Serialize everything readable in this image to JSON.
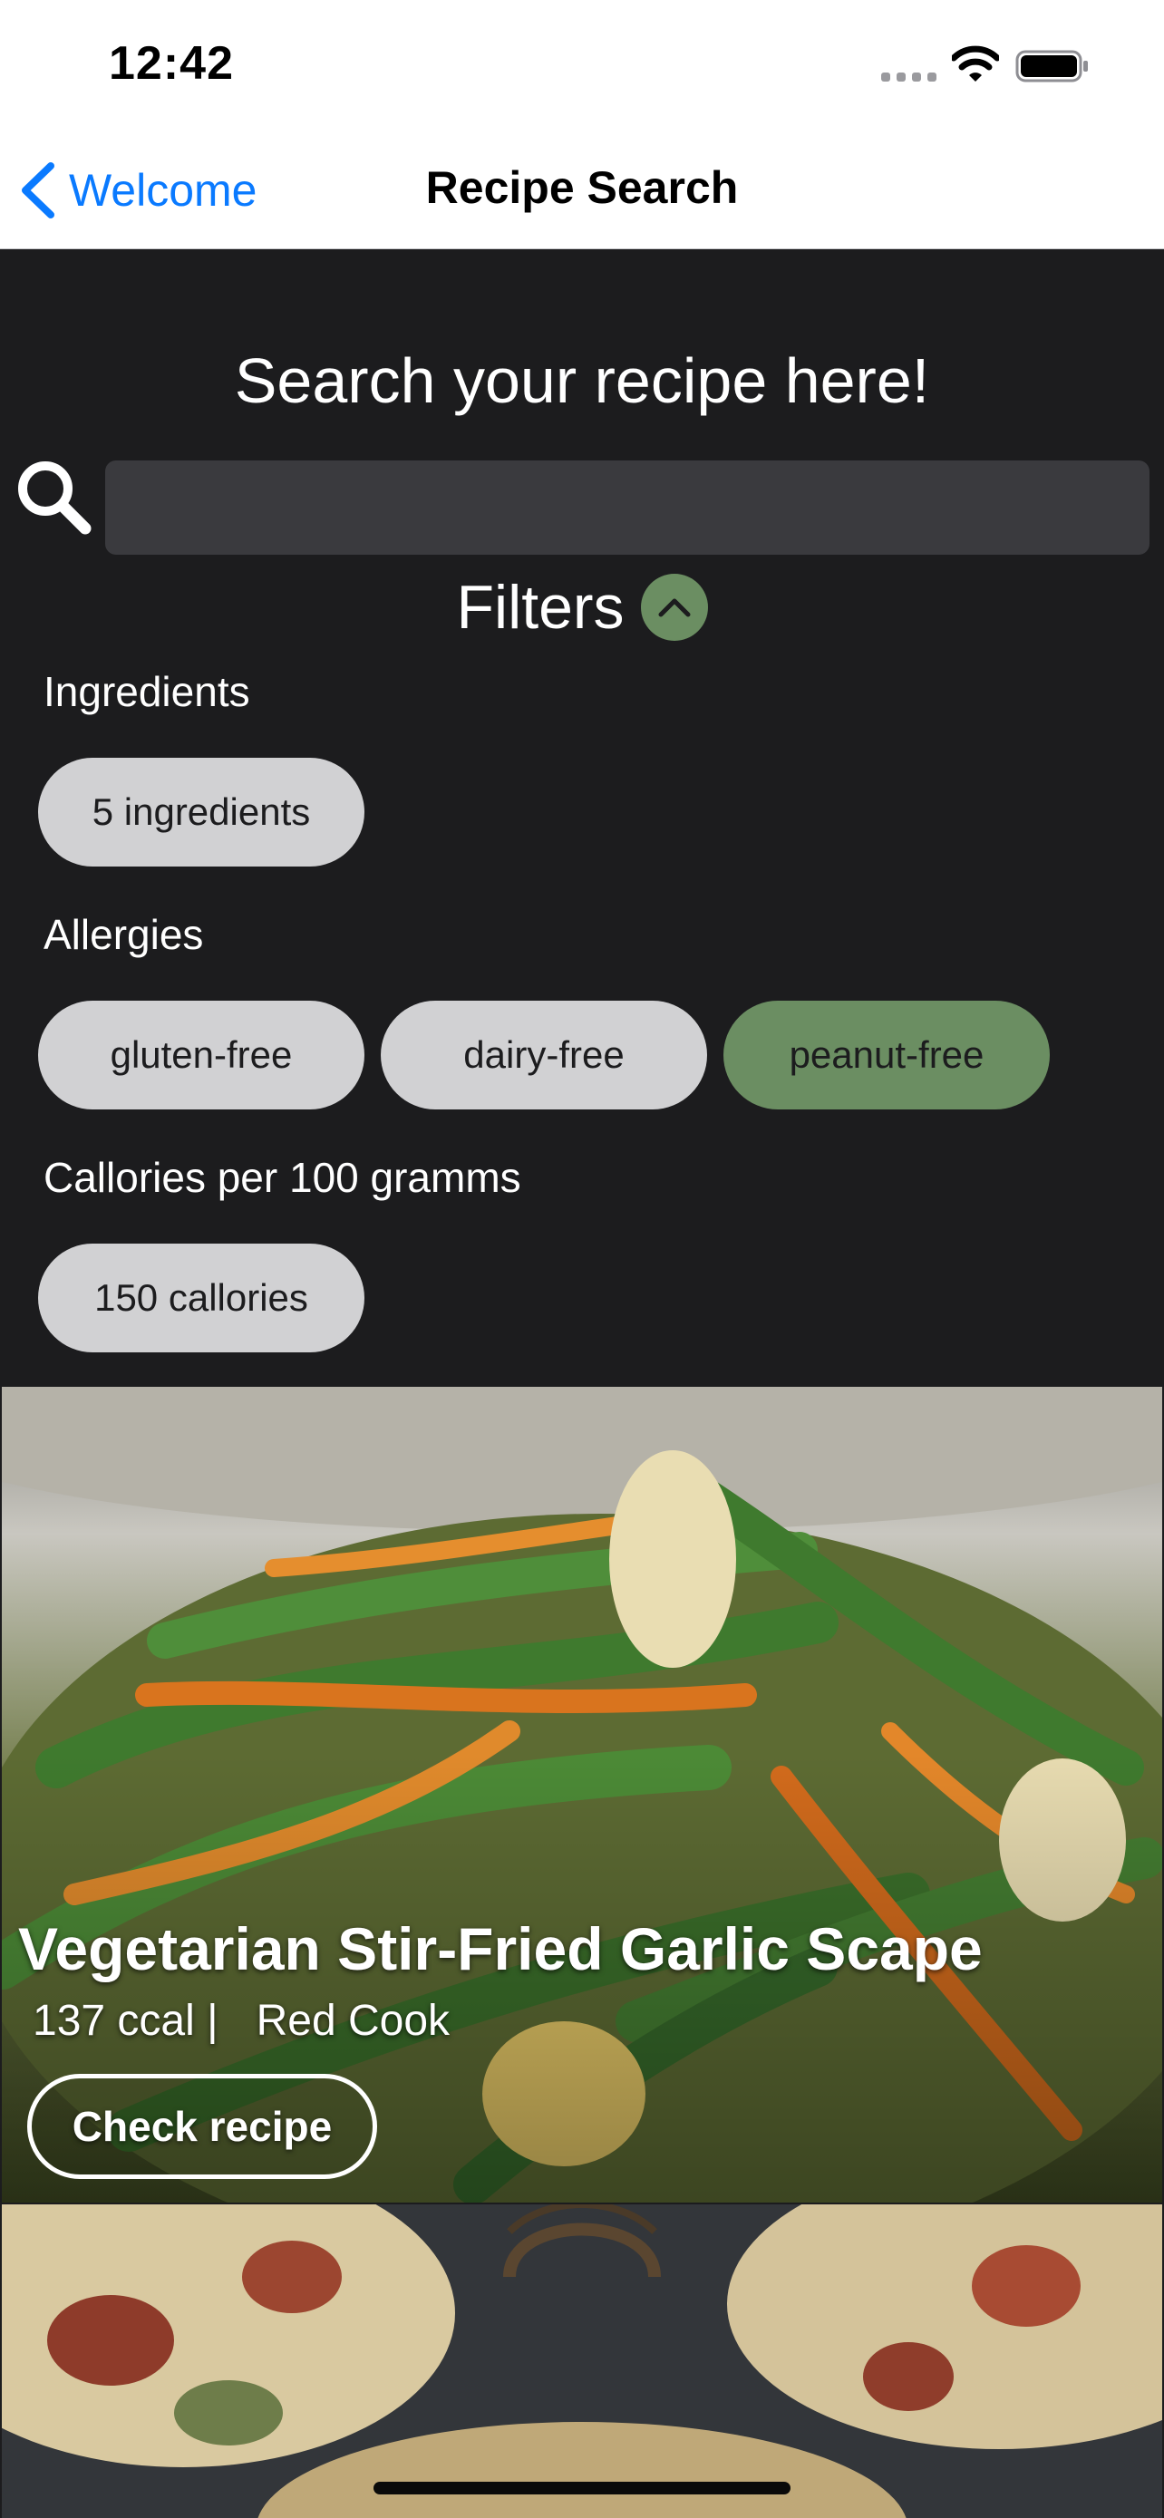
{
  "status_bar": {
    "time": "12:42"
  },
  "nav": {
    "back_label": "Welcome",
    "title": "Recipe Search"
  },
  "search": {
    "heading": "Search your recipe here!",
    "value": "",
    "placeholder": ""
  },
  "filters": {
    "label": "Filters",
    "expanded": true,
    "ingredients": {
      "label": "Ingredients",
      "chips": [
        {
          "label": "5 ingredients",
          "selected": false
        }
      ]
    },
    "allergies": {
      "label": "Allergies",
      "chips": [
        {
          "label": "gluten-free",
          "selected": false
        },
        {
          "label": "dairy-free",
          "selected": false
        },
        {
          "label": "peanut-free",
          "selected": true
        }
      ]
    },
    "calories": {
      "label": "Callories per 100 gramms",
      "chips": [
        {
          "label": "150 callories",
          "selected": false
        }
      ]
    }
  },
  "recipes": [
    {
      "title": "Vegetarian Stir-Fried Garlic Scape",
      "calories": "137 ccal |",
      "source": "Red Cook",
      "button_label": "Check recipe"
    },
    {
      "title": "",
      "calories": "",
      "source": "",
      "button_label": ""
    }
  ],
  "colors": {
    "accent": "#6b8e62",
    "link": "#0a7aff",
    "background": "#1c1c1e",
    "chip": "#d1d1d3",
    "input": "#3a3a3e"
  }
}
